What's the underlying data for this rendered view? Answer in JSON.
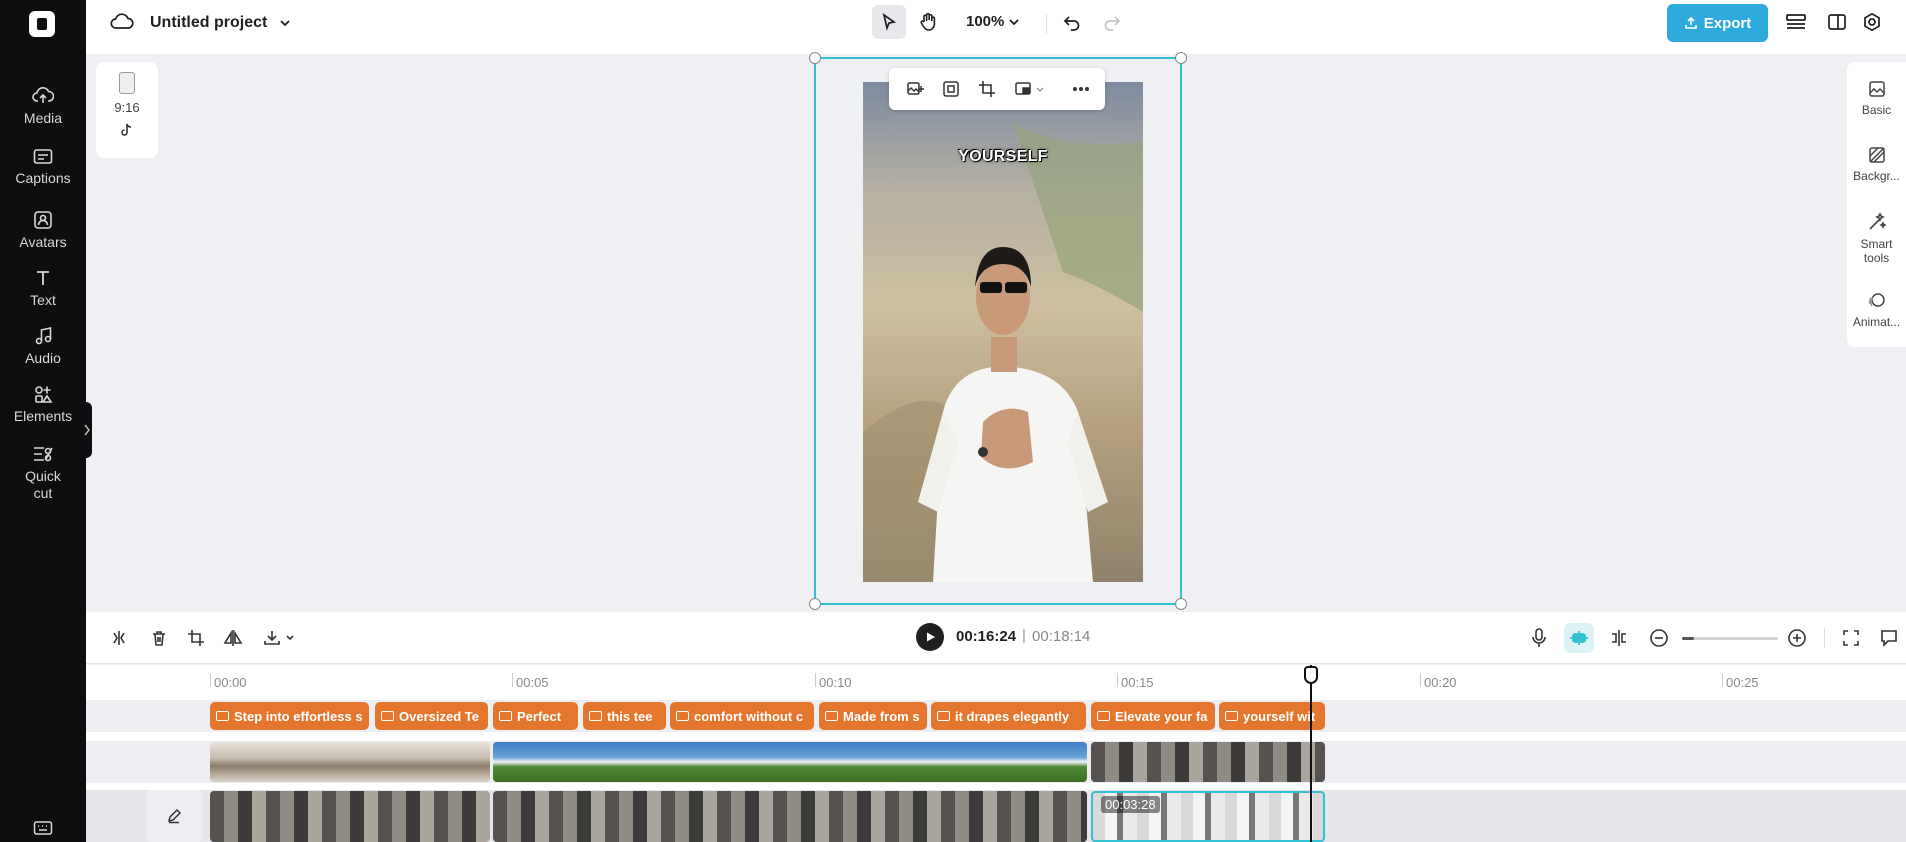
{
  "sidebar": {
    "items": [
      {
        "label": "Media",
        "icon": "upload-cloud-icon"
      },
      {
        "label": "Captions",
        "icon": "captions-icon"
      },
      {
        "label": "Avatars",
        "icon": "avatar-icon"
      },
      {
        "label": "Text",
        "icon": "text-icon"
      },
      {
        "label": "Audio",
        "icon": "music-note-icon"
      },
      {
        "label": "Elements",
        "icon": "elements-icon"
      },
      {
        "label": "Quick\ncut",
        "icon": "quick-cut-icon"
      }
    ]
  },
  "header": {
    "project_title": "Untitled project",
    "zoom": "100%",
    "export_label": "Export"
  },
  "canvas": {
    "aspect_ratio": "9:16",
    "caption_text": "YOURSELF"
  },
  "right_panel": {
    "items": [
      {
        "label": "Basic"
      },
      {
        "label": "Backgr..."
      },
      {
        "label": "Smart\ntools"
      },
      {
        "label": "Animat..."
      }
    ]
  },
  "playback": {
    "current_time": "00:16:24",
    "separator": "|",
    "total_time": "00:18:14"
  },
  "timeline": {
    "ruler": [
      "00:00",
      "00:05",
      "00:10",
      "00:15",
      "00:20",
      "00:25"
    ],
    "captions": [
      "Step into effortless s",
      "Oversized Te",
      "Perfect",
      "this tee",
      "comfort without c",
      "Made from s",
      "it drapes elegantly",
      "Elevate your fa",
      "yourself wit"
    ],
    "selected_clip_duration": "00:03:28"
  },
  "colors": {
    "accent": "#31c1d1",
    "export_button": "#2eaadc",
    "caption_chip": "#e4762d",
    "sidebar_bg": "#0e0e10"
  }
}
